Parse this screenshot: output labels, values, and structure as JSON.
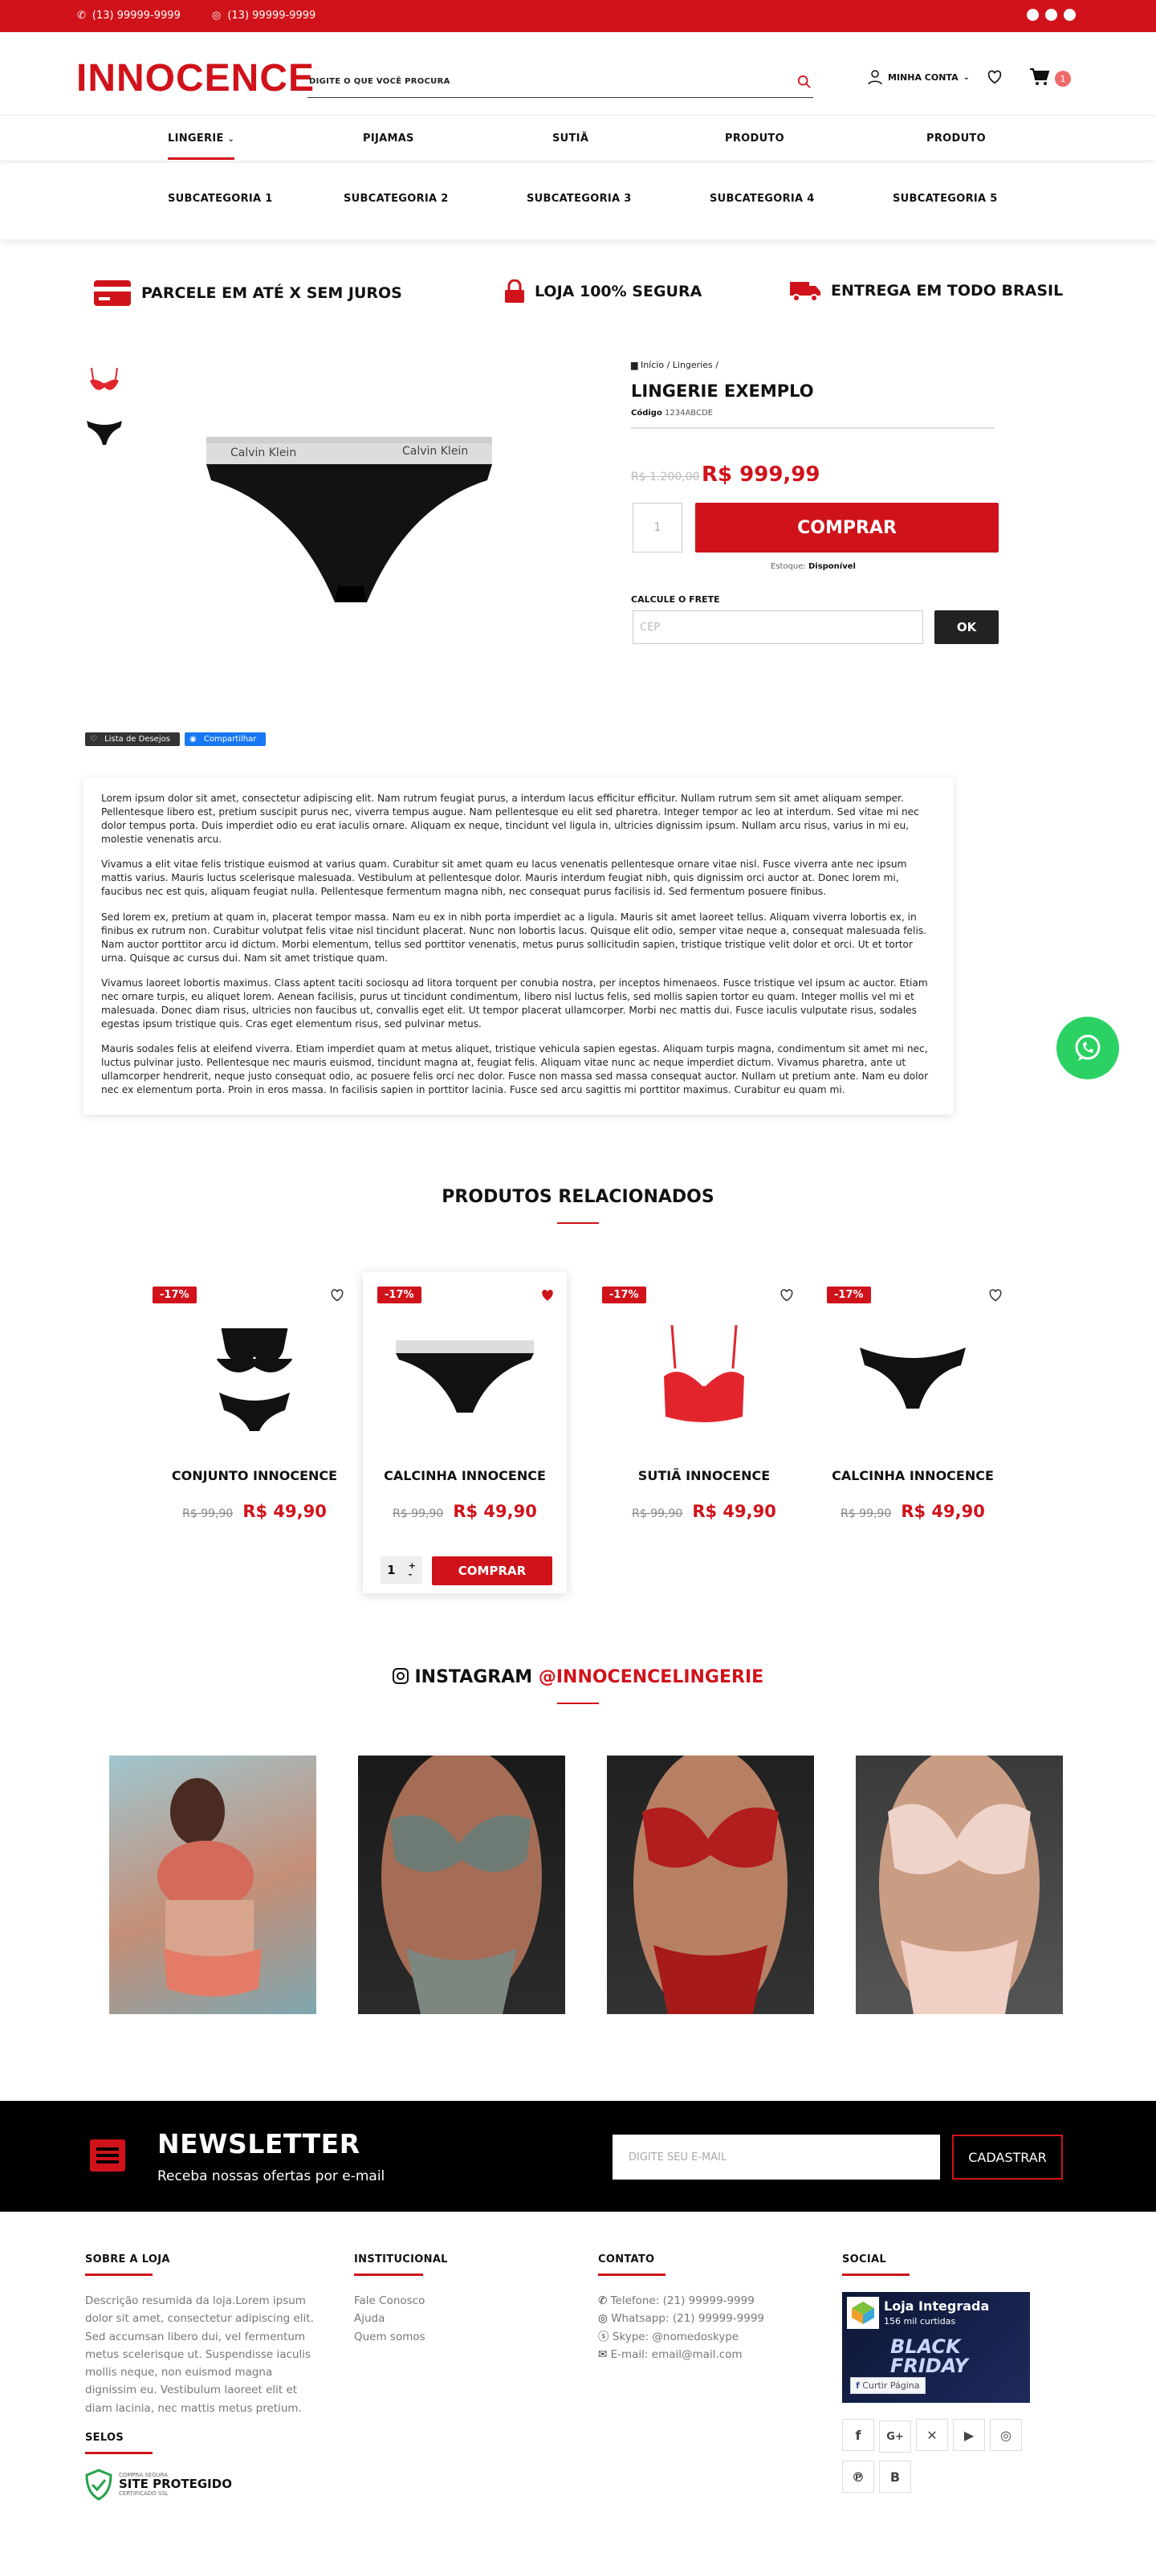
{
  "topbar": {
    "phone": "(13) 99999-9999",
    "whatsapp": "(13) 99999-9999"
  },
  "header": {
    "logo": "INNOCENCE",
    "search_placeholder": "DIGITE O QUE VOCÊ PROCURA",
    "account": "MINHA CONTA",
    "cart_count": "1"
  },
  "menu": [
    "LINGERIE",
    "PIJAMAS",
    "SUTIÃ",
    "PRODUTO",
    "PRODUTO"
  ],
  "submenu": [
    "SUBCATEGORIA 1",
    "SUBCATEGORIA 2",
    "SUBCATEGORIA 3",
    "SUBCATEGORIA 4",
    "SUBCATEGORIA 5"
  ],
  "benefits": [
    "PARCELE EM ATÉ X SEM JUROS",
    "LOJA 100% SEGURA",
    "ENTREGA EM TODO BRASIL"
  ],
  "product": {
    "breadcrumb": "Início / Lingeries /",
    "title": "LINGERIE EXEMPLO",
    "code_label": "Código",
    "code": "1234ABCDE",
    "old_price": "R$ 1.200,00",
    "price": "R$ 999,99",
    "qty": "1",
    "buy": "COMPRAR",
    "stock_label": "Estoque:",
    "stock": "Disponível",
    "shipping_label": "CALCULE O FRETE",
    "cep_placeholder": "CEP",
    "ok": "OK",
    "wishlist": "Lista de Desejos",
    "share": "Compartilhar",
    "image_brand": "Calvin Klein"
  },
  "description": [
    "Lorem ipsum dolor sit amet, consectetur adipiscing elit. Nam rutrum feugiat purus, a interdum lacus efficitur efficitur. Nullam rutrum sem sit amet aliquam semper. Pellentesque libero est, pretium suscipit purus nec, viverra tempus augue. Nam pellentesque eu elit sed pharetra. Integer tempor ac leo at interdum. Sed vitae mi nec dolor tempus porta. Duis imperdiet odio eu erat iaculis ornare. Aliquam ex neque, tincidunt vel ligula in, ultricies dignissim ipsum. Nullam arcu risus, varius in mi eu, molestie venenatis arcu.",
    "Vivamus a elit vitae felis tristique euismod at varius quam. Curabitur sit amet quam eu lacus venenatis pellentesque ornare vitae nisl. Fusce viverra ante nec ipsum mattis varius. Mauris luctus scelerisque malesuada. Vestibulum at pellentesque dolor. Mauris interdum feugiat nibh, quis dignissim orci auctor at. Donec lorem mi, faucibus nec est quis, aliquam feugiat nulla. Pellentesque fermentum magna nibh, nec consequat purus facilisis id. Sed fermentum posuere finibus.",
    "Sed lorem ex, pretium at quam in, placerat tempor massa. Nam eu ex in nibh porta imperdiet ac a ligula. Mauris sit amet laoreet tellus. Aliquam viverra lobortis ex, in finibus ex rutrum non. Curabitur volutpat felis vitae nisl tincidunt placerat. Nunc non lobortis lacus. Quisque elit odio, semper vitae neque a, consequat malesuada felis. Nam auctor porttitor arcu id dictum. Morbi elementum, tellus sed porttitor venenatis, metus purus sollicitudin sapien, tristique tristique velit dolor et orci. Ut et tortor urna. Quisque ac cursus dui. Nam sit amet tristique quam.",
    "Vivamus laoreet lobortis maximus. Class aptent taciti sociosqu ad litora torquent per conubia nostra, per inceptos himenaeos. Fusce tristique vel ipsum ac auctor. Etiam nec ornare turpis, eu aliquet lorem. Aenean facilisis, purus ut tincidunt condimentum, libero nisl luctus felis, sed mollis sapien tortor eu quam. Integer mollis vel mi et malesuada. Donec diam risus, ultricies non faucibus ut, convallis eget elit. Ut tempor placerat ullamcorper. Morbi nec mattis dui. Fusce iaculis vulputate risus, sodales egestas ipsum tristique quis. Cras eget elementum risus, sed pulvinar metus.",
    "Mauris sodales felis at eleifend viverra. Etiam imperdiet quam at metus aliquet, tristique vehicula sapien egestas. Aliquam turpis magna, condimentum sit amet mi nec, luctus pulvinar justo. Pellentesque nec mauris euismod, tincidunt magna at, feugiat felis. Aliquam vitae nunc ac neque imperdiet dictum. Vivamus pharetra, ante ut ullamcorper hendrerit, neque justo consequat odio, ac posuere felis orci nec dolor. Fusce non massa sed massa consequat auctor. Nullam ut pretium ante. Nam eu dolor nec ex elementum porta. Proin in eros massa. In facilisis sapien in porttitor lacinia. Fusce sed arcu sagittis mi porttitor maximus. Curabitur eu quam mi."
  ],
  "related": {
    "title": "PRODUTOS RELACIONADOS",
    "items": [
      {
        "name": "CONJUNTO INNOCENCE",
        "discount": "-17%",
        "old": "R$ 99,90",
        "price": "R$ 49,90"
      },
      {
        "name": "CALCINHA INNOCENCE",
        "discount": "-17%",
        "old": "R$ 99,90",
        "price": "R$ 49,90",
        "qty": "1",
        "buy": "COMPRAR"
      },
      {
        "name": "SUTIÃ INNOCENCE",
        "discount": "-17%",
        "old": "R$ 99,90",
        "price": "R$ 49,90"
      },
      {
        "name": "CALCINHA INNOCENCE",
        "discount": "-17%",
        "old": "R$ 99,90",
        "price": "R$ 49,90"
      }
    ]
  },
  "instagram": {
    "label": "INSTAGRAM",
    "handle": "@INNOCENCELINGERIE"
  },
  "newsletter": {
    "title": "NEWSLETTER",
    "subtitle": "Receba nossas ofertas por e-mail",
    "placeholder": "DIGITE SEU E-MAIL",
    "button": "CADASTRAR"
  },
  "footer": {
    "about_title": "SOBRE A LOJA",
    "about": "Descrição resumida da loja.Lorem ipsum dolor sit amet, consectetur adipiscing elit. Sed accumsan libero dui, vel fermentum metus scelerisque ut. Suspendisse iaculis mollis neque, non euismod magna dignissim eu. Vestibulum laoreet elit et diam lacinia, nec mattis metus pretium.",
    "selos_title": "SELOS",
    "seal_small": "COMPRA SEGURA",
    "seal_big": "SITE PROTEGIDO",
    "seal_sub": "CERTIFICADO SSL",
    "inst_title": "INSTITUCIONAL",
    "inst_links": [
      "Fale Conosco",
      "Ajuda",
      "Quem somos"
    ],
    "contact_title": "CONTATO",
    "contacts": [
      "Telefone: (21) 99999-9999",
      "Whatsapp: (21) 99999-9999",
      "Skype: @nomedoskype",
      "E-mail: email@mail.com"
    ],
    "social_title": "SOCIAL",
    "fb_page": "Loja Integrada",
    "fb_likes": "156 mil curtidas",
    "fb_like_btn": "Curtir Página",
    "fb_banner": "BLACK FRIDAY"
  }
}
